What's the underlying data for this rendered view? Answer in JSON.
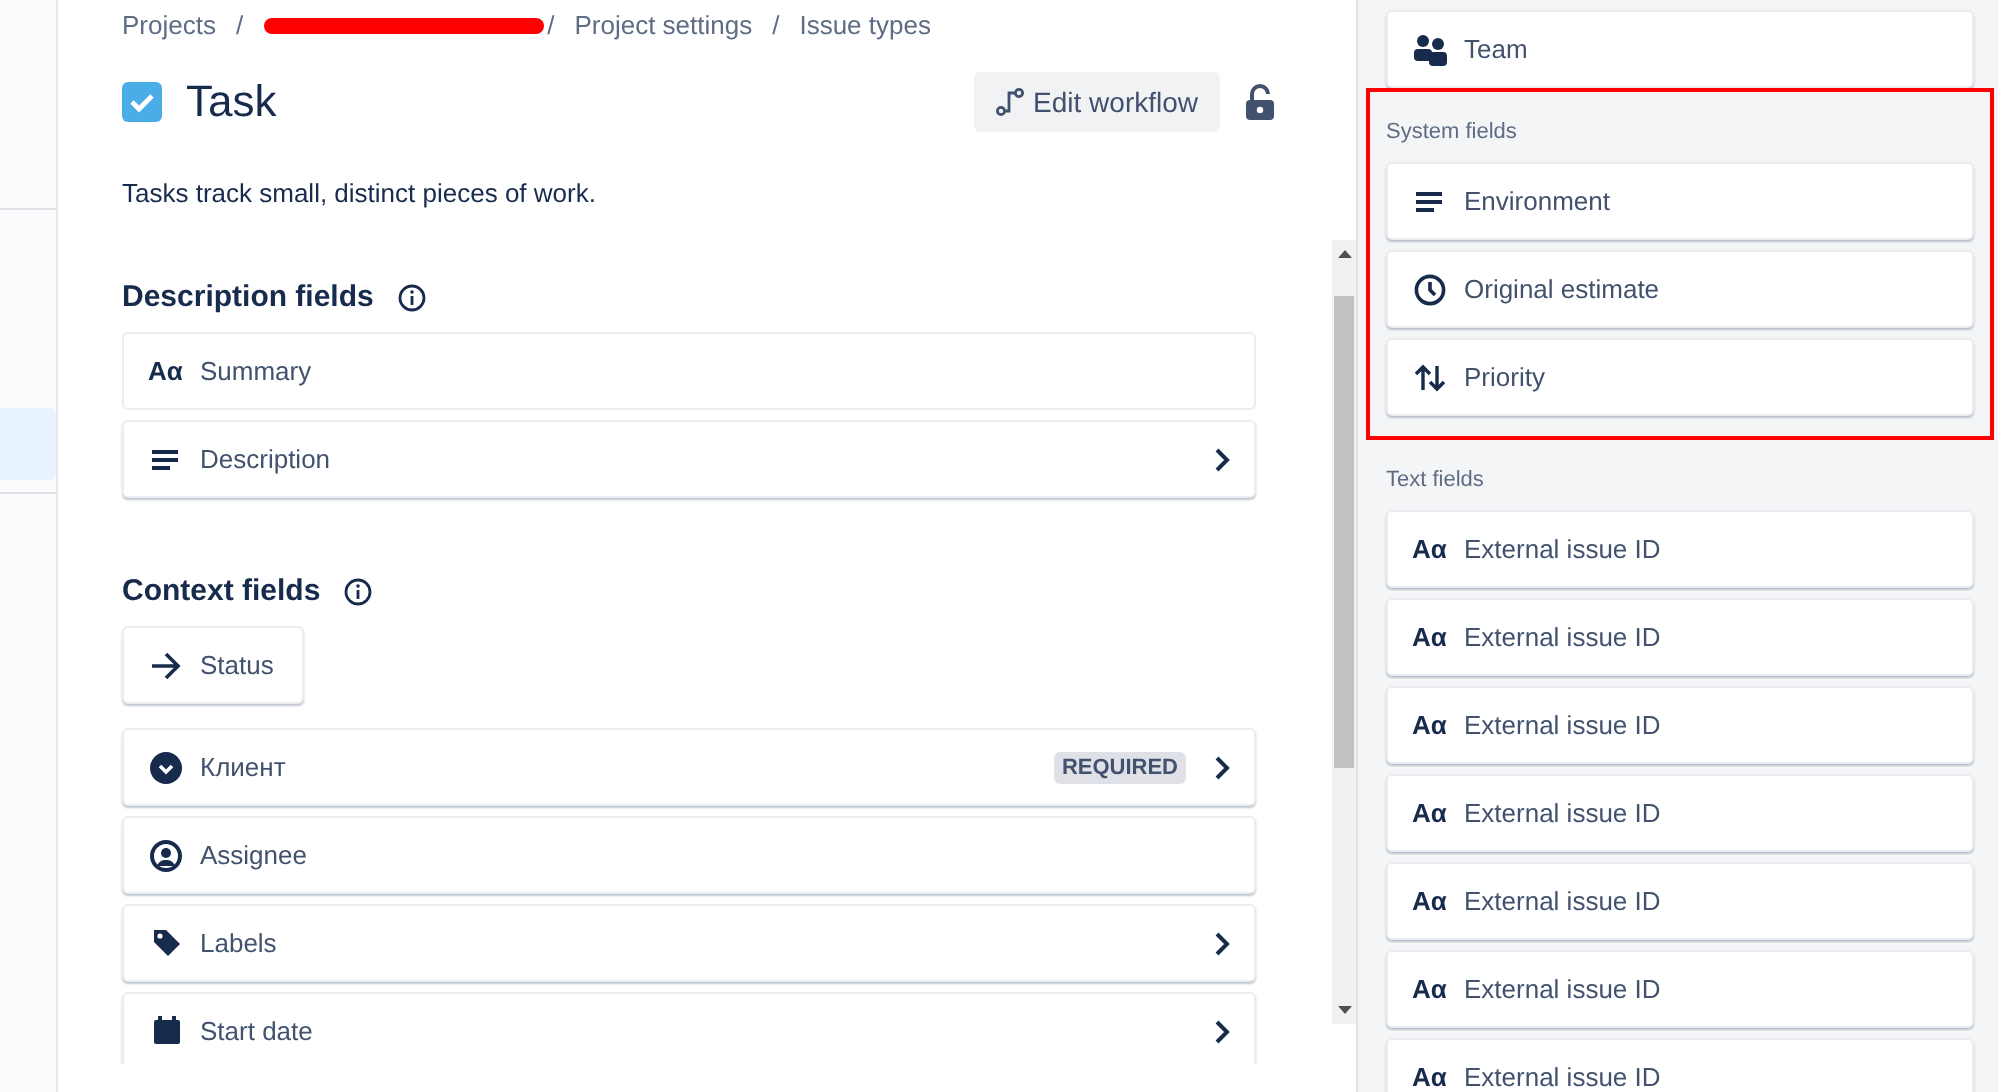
{
  "breadcrumbs": [
    "Projects",
    "Project settings",
    "Issue types"
  ],
  "breadcrumb_separators": [
    "/",
    "/",
    "/"
  ],
  "issue_type": {
    "title": "Task",
    "description": "Tasks track small, distinct pieces of work."
  },
  "edit_workflow_button": "Edit workflow",
  "sections": [
    {
      "title": "Description fields",
      "fields": [
        {
          "kind": "text",
          "glyph": "Aα",
          "label": "Summary",
          "chevron": false,
          "inline": false
        },
        {
          "kind": "paragraph",
          "label": "Description",
          "chevron": true,
          "inline": false
        }
      ]
    },
    {
      "title": "Context fields",
      "fields": [
        {
          "kind": "arrow",
          "label": "Status",
          "chevron": false,
          "inline": true
        },
        {
          "kind": "select",
          "label": "Клиент",
          "badge": "REQUIRED",
          "chevron": true,
          "inline": false
        },
        {
          "kind": "user",
          "label": "Assignee",
          "chevron": false,
          "inline": false
        },
        {
          "kind": "tag",
          "label": "Labels",
          "chevron": true,
          "inline": false
        },
        {
          "kind": "calendar",
          "label": "Start date",
          "chevron": true,
          "inline": false
        }
      ]
    }
  ],
  "palette": {
    "top_fields": [
      {
        "kind": "team",
        "label": "Team"
      }
    ],
    "groups": [
      {
        "title": "System fields",
        "highlighted": true,
        "fields": [
          {
            "kind": "paragraph",
            "label": "Environment"
          },
          {
            "kind": "clock",
            "label": "Original estimate"
          },
          {
            "kind": "sort",
            "label": "Priority"
          }
        ]
      },
      {
        "title": "Text fields",
        "highlighted": false,
        "fields": [
          {
            "kind": "text",
            "glyph": "Aα",
            "label": "External issue ID"
          },
          {
            "kind": "text",
            "glyph": "Aα",
            "label": "External issue ID"
          },
          {
            "kind": "text",
            "glyph": "Aα",
            "label": "External issue ID"
          },
          {
            "kind": "text",
            "glyph": "Aα",
            "label": "External issue ID"
          },
          {
            "kind": "text",
            "glyph": "Aα",
            "label": "External issue ID"
          },
          {
            "kind": "text",
            "glyph": "Aα",
            "label": "External issue ID"
          },
          {
            "kind": "text",
            "glyph": "Aα",
            "label": "External issue ID"
          }
        ]
      }
    ]
  }
}
